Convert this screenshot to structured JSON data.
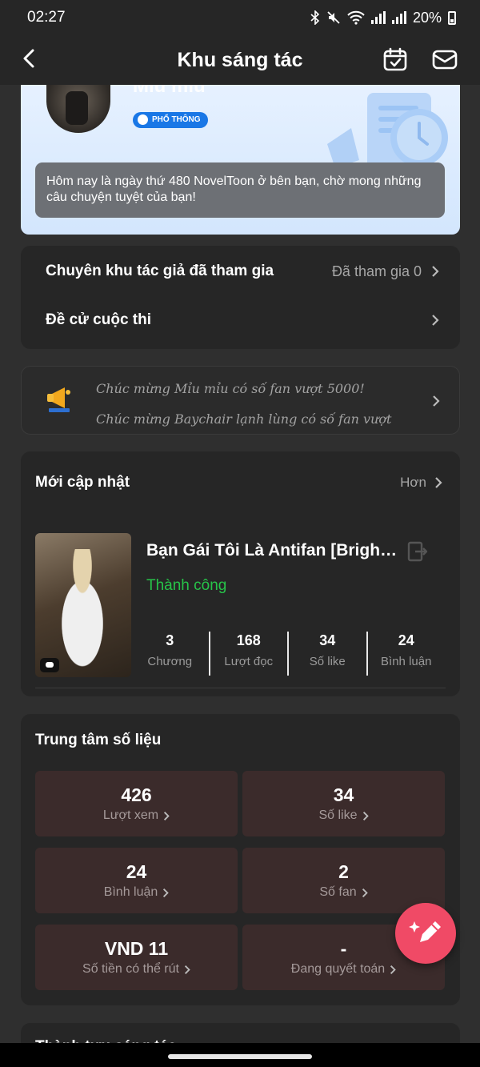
{
  "status_bar": {
    "time": "02:27",
    "battery": "20%"
  },
  "header": {
    "title": "Khu sáng tác"
  },
  "profile": {
    "name": "Mỉu mỉu",
    "badge": "PHỔ THÔNG",
    "welcome": "Hôm nay là ngày thứ 480 NovelToon ở bên bạn, chờ mong những câu chuyện tuyệt của bạn!"
  },
  "menu": [
    {
      "label": "Chuyên khu tác giả đã tham gia",
      "value": "Đã tham gia 0"
    },
    {
      "label": "Đề cử cuộc thi",
      "value": ""
    }
  ],
  "notice": {
    "line1": "Chúc mừng Mỉu mỉu có số fan vượt 5000!",
    "line2": "Chúc mừng Baychair lạnh lùng có số fan vượt"
  },
  "recent": {
    "title": "Mới cập nhật",
    "more": "Hơn",
    "book": {
      "title": "Bạn Gái Tôi Là Antifan [Brightness]",
      "status": "Thành công",
      "stats": [
        {
          "value": "3",
          "label": "Chương"
        },
        {
          "value": "168",
          "label": "Lượt đọc"
        },
        {
          "value": "34",
          "label": "Số like"
        },
        {
          "value": "24",
          "label": "Bình luận"
        }
      ]
    }
  },
  "data_center": {
    "title": "Trung tâm số liệu",
    "tiles": [
      {
        "value": "426",
        "label": "Lượt xem"
      },
      {
        "value": "34",
        "label": "Số like"
      },
      {
        "value": "24",
        "label": "Bình luận"
      },
      {
        "value": "2",
        "label": "Số fan"
      },
      {
        "value": "VND 11",
        "label": "Số tiền có thể rút"
      },
      {
        "value": "-",
        "label": "Đang quyết toán"
      }
    ]
  },
  "achievement": {
    "title": "Thành tựu sáng tác"
  },
  "colors": {
    "accent": "#f04a66",
    "success": "#27c449",
    "badge": "#1977e6",
    "tile": "#3b2b2b"
  }
}
